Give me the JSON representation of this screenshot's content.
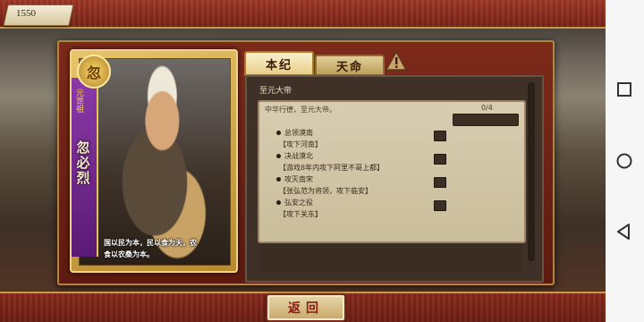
{
  "hud": {
    "score": "1550"
  },
  "hero": {
    "rank_glyph": "忽",
    "title": "元世祖",
    "name": "忽必烈",
    "quote_line1": "国以民为本，民以食为天，农",
    "quote_line2": "食以农桑为本。"
  },
  "tabs": [
    {
      "label": "本纪",
      "active": true
    },
    {
      "label": "天命",
      "active": false
    }
  ],
  "content": {
    "header": "至元大帝",
    "quest_description": "中华行德，至元大帝。",
    "progress_text": "0/4",
    "progress_value": 0,
    "objectives": [
      {
        "title": "总领漠南",
        "hint": "【攻下河南】"
      },
      {
        "title": "决战漠北",
        "hint": "【游戏8年内攻下阿里不哥上都】"
      },
      {
        "title": "攻灭南宋",
        "hint": "【张弘范为将领，攻下临安】"
      },
      {
        "title": "弘安之役",
        "hint": "【攻下关东】"
      }
    ]
  },
  "footer": {
    "back_label": "返回"
  },
  "android_nav": {
    "icons": [
      "square-icon",
      "circle-icon",
      "triangle-back-icon"
    ]
  },
  "colors": {
    "banner_red": "#8a2a1c",
    "gold": "#c89a48",
    "parchment": "#d8cdb0"
  }
}
